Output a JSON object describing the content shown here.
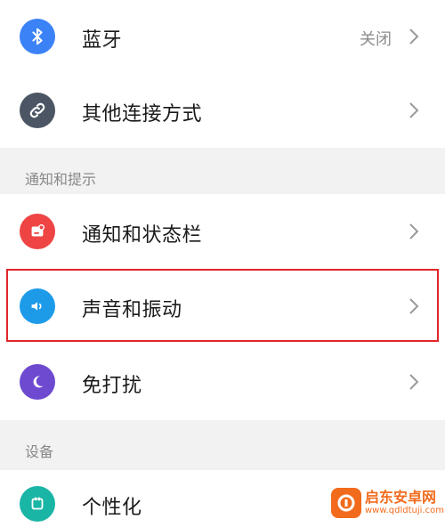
{
  "rows": {
    "bluetooth": {
      "label": "蓝牙",
      "value": "关闭",
      "icon": "bluetooth-icon",
      "color": "#3b82f6"
    },
    "other_connections": {
      "label": "其他连接方式",
      "icon": "link-icon",
      "color": "#4b5563"
    },
    "notifications": {
      "label": "通知和状态栏",
      "icon": "notification-icon",
      "color": "#ef4444"
    },
    "sound": {
      "label": "声音和振动",
      "icon": "speaker-icon",
      "color": "#1e9be8"
    },
    "dnd": {
      "label": "免打扰",
      "icon": "moon-icon",
      "color": "#6d4ad0"
    },
    "personalize": {
      "label": "个性化",
      "icon": "palette-icon",
      "color": "#19b5a5"
    }
  },
  "sections": {
    "notify_title": "通知和提示",
    "device_title": "设备"
  },
  "watermark": {
    "title": "启东安卓网",
    "url": "www.qdldtuji.com"
  },
  "colors": {
    "highlight_border": "#e0262a",
    "section_bg": "#f2f2f2"
  }
}
